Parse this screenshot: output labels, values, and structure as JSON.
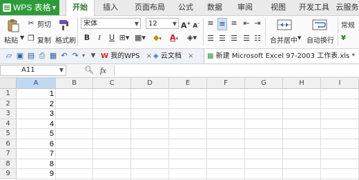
{
  "app": {
    "title": "WPS 表格",
    "accent": "#2e9b3a"
  },
  "menu": {
    "tabs": [
      {
        "label": "开始",
        "active": true
      },
      {
        "label": "插入"
      },
      {
        "label": "页面布局"
      },
      {
        "label": "公式"
      },
      {
        "label": "数据"
      },
      {
        "label": "审阅"
      },
      {
        "label": "视图"
      },
      {
        "label": "开发工具"
      },
      {
        "label": "云服务"
      }
    ]
  },
  "ribbon": {
    "paste": "粘贴",
    "cut": "剪切",
    "copy": "复制",
    "format_painter": "格式刷",
    "font_name": "宋体",
    "font_size": "12",
    "merge_center": "合并居中",
    "wrap_text": "自动换行",
    "number_format": "常规"
  },
  "doc_tabs": [
    {
      "label": "我的WPS",
      "active": false
    },
    {
      "label": "云文档",
      "active": false
    },
    {
      "label": "新建 Microsoft Excel 97-2003 工作表.xls *",
      "active": true
    }
  ],
  "formula_bar": {
    "name_box": "A11",
    "fx": "fx",
    "content": ""
  },
  "sheet": {
    "columns": [
      "A",
      "B",
      "C",
      "D",
      "E",
      "F",
      "G",
      "H",
      "I"
    ],
    "selected_column": "A",
    "rows": [
      "1",
      "2",
      "3",
      "4",
      "5",
      "6",
      "7",
      "8",
      "9"
    ],
    "column_a_values": [
      "1",
      "2",
      "3",
      "4",
      "5",
      "6",
      "7",
      "8",
      "9"
    ]
  }
}
